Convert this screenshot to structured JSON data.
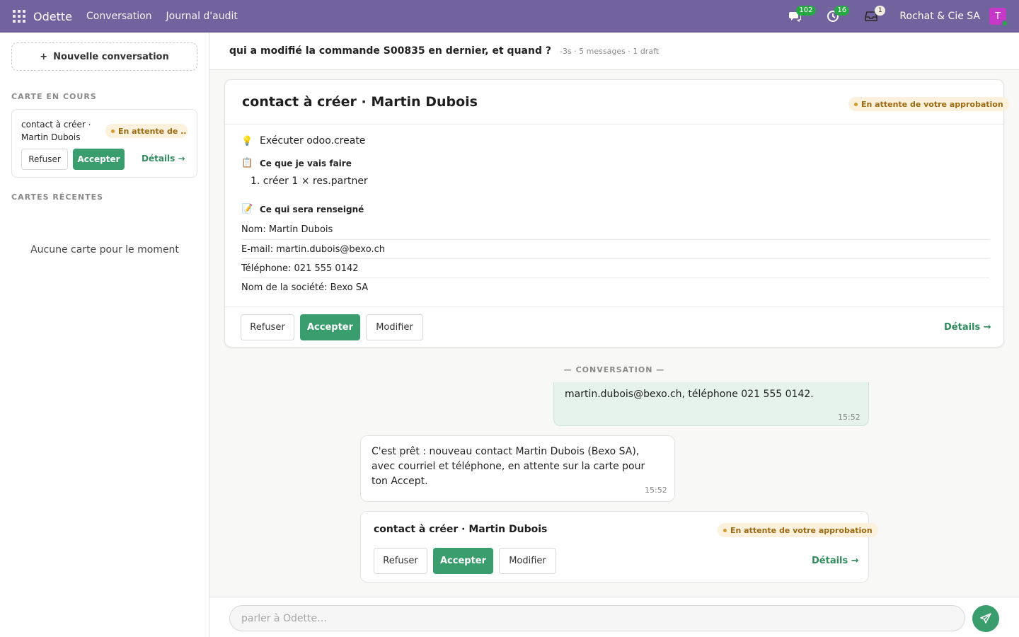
{
  "navbar": {
    "app_name": "Odette",
    "menu": [
      "Conversation",
      "Journal d'audit"
    ],
    "messages_count": "102",
    "activities_count": "16",
    "notifications_count": "1",
    "company": "Rochat & Cie SA",
    "user_initial": "T",
    "icons": [
      "apps-icon",
      "chat-icon",
      "clock-icon",
      "inbox-icon"
    ]
  },
  "sidebar": {
    "new_conversation_label": "Nouvelle conversation",
    "current_title": "CARTE EN COURS",
    "current_card": {
      "title": "contact à créer · Martin Dubois",
      "status": "En attente de ...",
      "refuse": "Refuser",
      "accept": "Accepter",
      "details": "Détails →"
    },
    "recent_title": "CARTES RÉCENTES",
    "empty_text": "Aucune carte pour le moment"
  },
  "main": {
    "conversation_title": "qui a modifié la commande S00835 en dernier, et quand ?",
    "conversation_meta": "-3s · 5 messages · 1 draft",
    "card": {
      "title": "contact à créer · Martin Dubois",
      "status": "En attente de votre approbation",
      "action": "Exécuter odoo.create",
      "plan_heading": "Ce que je vais faire",
      "plan_item": "1. créer 1 × res.partner",
      "fields_heading": "Ce qui sera renseigné",
      "fields": [
        "Nom: Martin Dubois",
        "E-mail: martin.dubois@bexo.ch",
        "Téléphone: 021 555 0142",
        "Nom de la société: Bexo SA"
      ],
      "refuse": "Refuser",
      "accept": "Accepter",
      "modify": "Modifier",
      "details": "Détails →"
    },
    "divider": "— CONVERSATION —",
    "messages": {
      "user_text": "martin.dubois@bexo.ch, téléphone 021 555 0142.",
      "user_time": "15:52",
      "bot_text": "C'est prêt : nouveau contact Martin Dubois (Bexo SA), avec courriel et téléphone, en attente sur la carte pour ton Accept.",
      "bot_time": "15:52"
    },
    "inline_card": {
      "title": "contact à créer · Martin Dubois",
      "status": "En attente de votre approbation",
      "refuse": "Refuser",
      "accept": "Accepter",
      "modify": "Modifier",
      "details": "Détails →"
    },
    "composer_placeholder": "parler à Odette…",
    "colors": {
      "navbar": "#71639e",
      "primary": "#3a9d6e",
      "pending": "#d39a2b"
    }
  }
}
